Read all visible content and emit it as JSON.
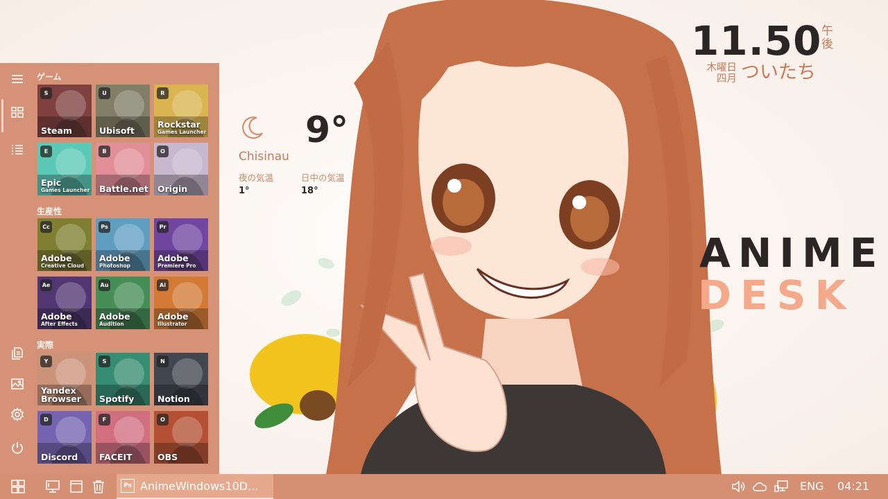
{
  "colors": {
    "accent": "#d58f72",
    "accent_dark": "#c97a58",
    "brand_light": "#f3a98a",
    "text_dark": "#2a2626"
  },
  "start_menu": {
    "rail": [
      {
        "icon": "hamburger-menu-icon"
      },
      {
        "icon": "tiles-grid-icon"
      },
      {
        "icon": "list-icon"
      },
      {
        "icon": "documents-icon"
      },
      {
        "icon": "pictures-icon"
      },
      {
        "icon": "settings-gear-icon"
      },
      {
        "icon": "power-icon"
      }
    ],
    "sections": [
      {
        "title": "ゲーム",
        "tiles": [
          {
            "label": "Steam",
            "sub": "",
            "badge": "steam-icon",
            "badge_text": "S",
            "color": "#7a3a3a"
          },
          {
            "label": "Ubisoft",
            "sub": "",
            "badge": "ubisoft-icon",
            "badge_text": "U",
            "color": "#7c7a62"
          },
          {
            "label": "Rockstar",
            "sub": "Games Launcher",
            "badge": "rockstar-icon",
            "badge_text": "R",
            "color": "#d8b24a"
          },
          {
            "label": "Epic",
            "sub": "Games Launcher",
            "badge": "epic-icon",
            "badge_text": "E",
            "color": "#55c8b4"
          },
          {
            "label": "Battle.net",
            "sub": "",
            "badge": "battlenet-icon",
            "badge_text": "B",
            "color": "#e28a96"
          },
          {
            "label": "Origin",
            "sub": "",
            "badge": "origin-icon",
            "badge_text": "O",
            "color": "#c7b5ce"
          }
        ]
      },
      {
        "title": "生産性",
        "tiles": [
          {
            "label": "Adobe",
            "sub": "Creative Cloud",
            "badge": "creative-cloud-icon",
            "badge_text": "Cc",
            "color": "#7b7a2a"
          },
          {
            "label": "Adobe",
            "sub": "Photoshop",
            "badge": "photoshop-icon",
            "badge_text": "Ps",
            "color": "#5a9bc0"
          },
          {
            "label": "Adobe",
            "sub": "Premiere Pro",
            "badge": "premiere-icon",
            "badge_text": "Pr",
            "color": "#6c3f9e"
          },
          {
            "label": "Adobe",
            "sub": "After Effects",
            "badge": "after-effects-icon",
            "badge_text": "Ae",
            "color": "#4a2f6e"
          },
          {
            "label": "Adobe",
            "sub": "Audition",
            "badge": "audition-icon",
            "badge_text": "Au",
            "color": "#3f8a52"
          },
          {
            "label": "Adobe",
            "sub": "Illustrator",
            "badge": "illustrator-icon",
            "badge_text": "Ai",
            "color": "#d2762f"
          }
        ]
      },
      {
        "title": "実際",
        "tiles": [
          {
            "label": "Yandex",
            "sub_big": "Browser",
            "sub": "",
            "badge": "yandex-icon",
            "badge_text": "Y",
            "color": "#c99076"
          },
          {
            "label": "Spotify",
            "sub": "",
            "badge": "spotify-icon",
            "badge_text": "S",
            "color": "#2f8a6e"
          },
          {
            "label": "Notion",
            "sub": "",
            "badge": "notion-icon",
            "badge_text": "N",
            "color": "#3b3f4a"
          },
          {
            "label": "Discord",
            "sub": "",
            "badge": "discord-icon",
            "badge_text": "D",
            "color": "#6f5fb0"
          },
          {
            "label": "FACEIT",
            "sub": "",
            "badge": "faceit-icon",
            "badge_text": "F",
            "color": "#d06a7d"
          },
          {
            "label": "OBS",
            "sub": "",
            "badge": "obs-icon",
            "badge_text": "O",
            "color": "#b24b2e"
          }
        ]
      }
    ]
  },
  "weather": {
    "icon": "crescent-moon-icon",
    "temperature": "9°",
    "city": "Chisinau",
    "night_label": "夜の気温",
    "night_value": "1°",
    "day_label": "日中の気温",
    "day_value": "18°"
  },
  "clock": {
    "time": "11.50",
    "ampm": "午後",
    "weekday": "木曜日",
    "month": "四月",
    "date_text": "ついたち"
  },
  "brand": {
    "line1": "ANIME",
    "line2": "DESK"
  },
  "taskbar": {
    "start_icon": "windows-logo-icon",
    "quick": [
      "desktop-icon",
      "window-icon",
      "recycle-bin-icon"
    ],
    "app": {
      "icon": "photoshop-icon",
      "icon_text": "Ps",
      "label": "AnimeWindows10D..."
    },
    "tray": {
      "icons": [
        "volume-icon",
        "cloud-icon",
        "network-icon"
      ],
      "language": "ENG",
      "time": "04:21"
    }
  }
}
